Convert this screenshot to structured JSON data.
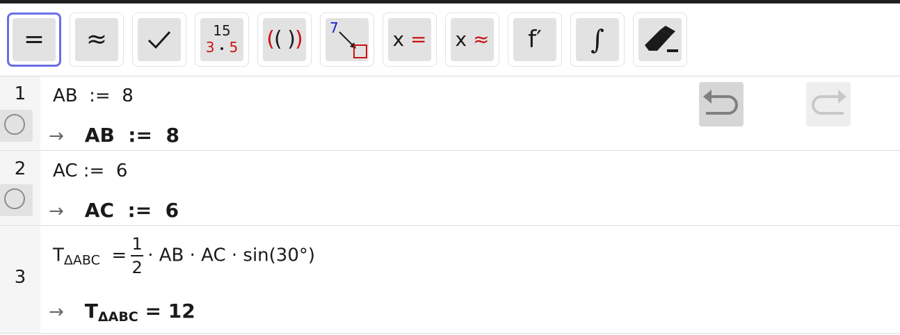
{
  "toolbar": {
    "tools": [
      {
        "label": "=",
        "name": "evaluate"
      },
      {
        "label": "≈",
        "name": "numeric"
      },
      {
        "label": "✓",
        "name": "keep-input"
      },
      {
        "top": "15",
        "bottom_left": "3",
        "dot": "•",
        "bottom_right": "5",
        "name": "factor"
      },
      {
        "label": "(( ))",
        "name": "expand"
      },
      {
        "top": "7",
        "name": "substitute"
      },
      {
        "x": "x",
        "op": "=",
        "name": "solve"
      },
      {
        "x": "x",
        "op": "≈",
        "name": "solve-numerically"
      },
      {
        "label": "f′",
        "name": "derivative"
      },
      {
        "label": "∫",
        "name": "integral"
      },
      {
        "name": "delete"
      }
    ],
    "accent": "#6a6ee6"
  },
  "cas": {
    "rows": [
      {
        "number": "1",
        "input": "AB  :=  8",
        "arrow": "→",
        "output": "AB  :=  8"
      },
      {
        "number": "2",
        "input": "AC :=  6",
        "arrow": "→",
        "output": "AC  :=  6"
      },
      {
        "number": "3",
        "input_lhs": "T",
        "input_sub": "ΔABC",
        "input_eq": "=",
        "frac_num": "1",
        "frac_den": "2",
        "input_rhs": "· AB · AC · sin(30°)",
        "arrow": "→",
        "output_lhs": "T",
        "output_sub": "ΔABC",
        "output_rhs": " = 12"
      }
    ]
  }
}
